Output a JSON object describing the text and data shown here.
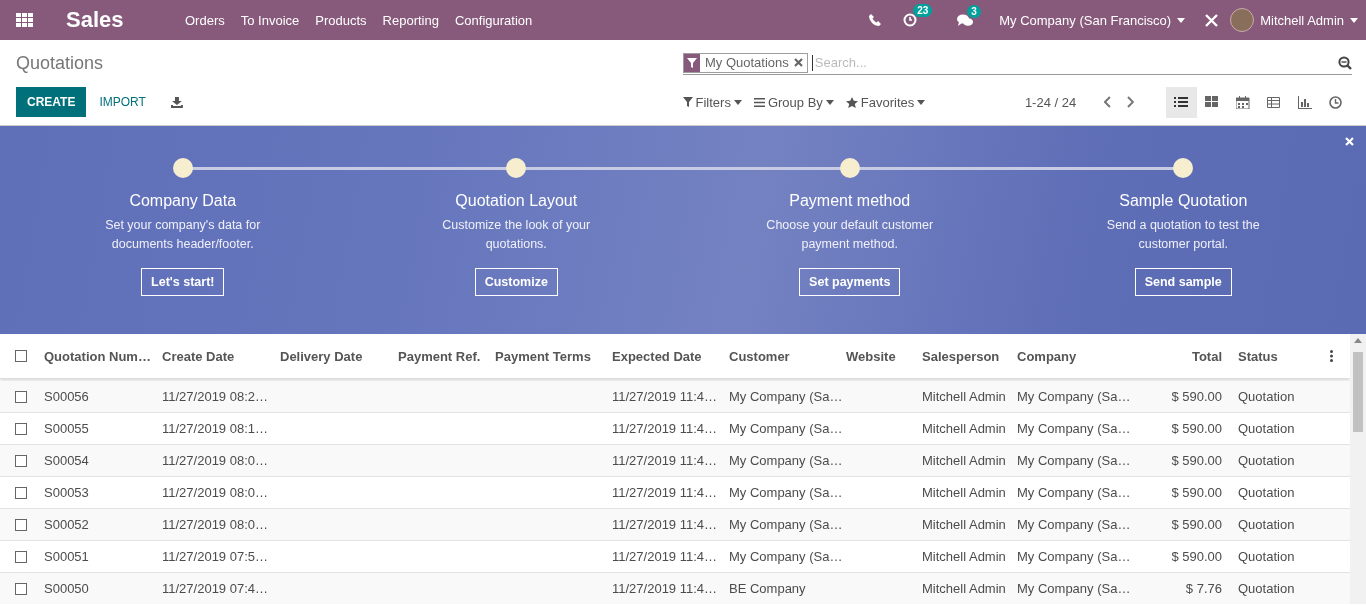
{
  "navbar": {
    "app_name": "Sales",
    "menu": [
      "Orders",
      "To Invoice",
      "Products",
      "Reporting",
      "Configuration"
    ],
    "activity_count": "23",
    "message_count": "3",
    "company": "My Company (San Francisco)",
    "user": "Mitchell Admin"
  },
  "control_panel": {
    "title": "Quotations",
    "create": "CREATE",
    "import": "IMPORT",
    "search": {
      "facets": [
        "My Quotations"
      ],
      "placeholder": "Search..."
    },
    "menus": [
      "Filters",
      "Group By",
      "Favorites"
    ],
    "pager": "1-24 / 24",
    "views": [
      {
        "kind": "list",
        "selected": true
      },
      {
        "kind": "kanban",
        "selected": false
      },
      {
        "kind": "calendar",
        "selected": false
      },
      {
        "kind": "pivot",
        "selected": false
      },
      {
        "kind": "graph",
        "selected": false
      },
      {
        "kind": "activity",
        "selected": false
      }
    ]
  },
  "banner": {
    "steps": [
      {
        "title": "Company Data",
        "description": "Set your company's data for documents header/footer.",
        "button": "Let's start!"
      },
      {
        "title": "Quotation Layout",
        "description": "Customize the look of your quotations.",
        "button": "Customize"
      },
      {
        "title": "Payment method",
        "description": "Choose your default customer payment method.",
        "button": "Set payments"
      },
      {
        "title": "Sample Quotation",
        "description": "Send a quotation to test the customer portal.",
        "button": "Send sample"
      }
    ]
  },
  "table": {
    "all_checked": false,
    "columns": [
      "Quotation Num…",
      "Create Date",
      "Delivery Date",
      "Payment Ref.",
      "Payment Terms",
      "Expected Date",
      "Customer",
      "Website",
      "Salesperson",
      "Company",
      "Total",
      "Status"
    ],
    "rows": [
      {
        "checked": false,
        "cells": [
          "S00056",
          "11/27/2019 08:2…",
          "",
          "",
          "",
          "11/27/2019 11:4…",
          "My Company (Sa…",
          "",
          "Mitchell Admin",
          "My Company (Sa…",
          "$ 590.00",
          "Quotation"
        ]
      },
      {
        "checked": false,
        "cells": [
          "S00055",
          "11/27/2019 08:1…",
          "",
          "",
          "",
          "11/27/2019 11:4…",
          "My Company (Sa…",
          "",
          "Mitchell Admin",
          "My Company (Sa…",
          "$ 590.00",
          "Quotation"
        ]
      },
      {
        "checked": false,
        "cells": [
          "S00054",
          "11/27/2019 08:0…",
          "",
          "",
          "",
          "11/27/2019 11:4…",
          "My Company (Sa…",
          "",
          "Mitchell Admin",
          "My Company (Sa…",
          "$ 590.00",
          "Quotation"
        ]
      },
      {
        "checked": false,
        "cells": [
          "S00053",
          "11/27/2019 08:0…",
          "",
          "",
          "",
          "11/27/2019 11:4…",
          "My Company (Sa…",
          "",
          "Mitchell Admin",
          "My Company (Sa…",
          "$ 590.00",
          "Quotation"
        ]
      },
      {
        "checked": false,
        "cells": [
          "S00052",
          "11/27/2019 08:0…",
          "",
          "",
          "",
          "11/27/2019 11:4…",
          "My Company (Sa…",
          "",
          "Mitchell Admin",
          "My Company (Sa…",
          "$ 590.00",
          "Quotation"
        ]
      },
      {
        "checked": false,
        "cells": [
          "S00051",
          "11/27/2019 07:5…",
          "",
          "",
          "",
          "11/27/2019 11:4…",
          "My Company (Sa…",
          "",
          "Mitchell Admin",
          "My Company (Sa…",
          "$ 590.00",
          "Quotation"
        ]
      },
      {
        "checked": false,
        "cells": [
          "S00050",
          "11/27/2019 07:4…",
          "",
          "",
          "",
          "11/27/2019 11:4…",
          "BE Company",
          "",
          "Mitchell Admin",
          "My Company (Sa…",
          "$ 7.76",
          "Quotation"
        ]
      }
    ]
  }
}
